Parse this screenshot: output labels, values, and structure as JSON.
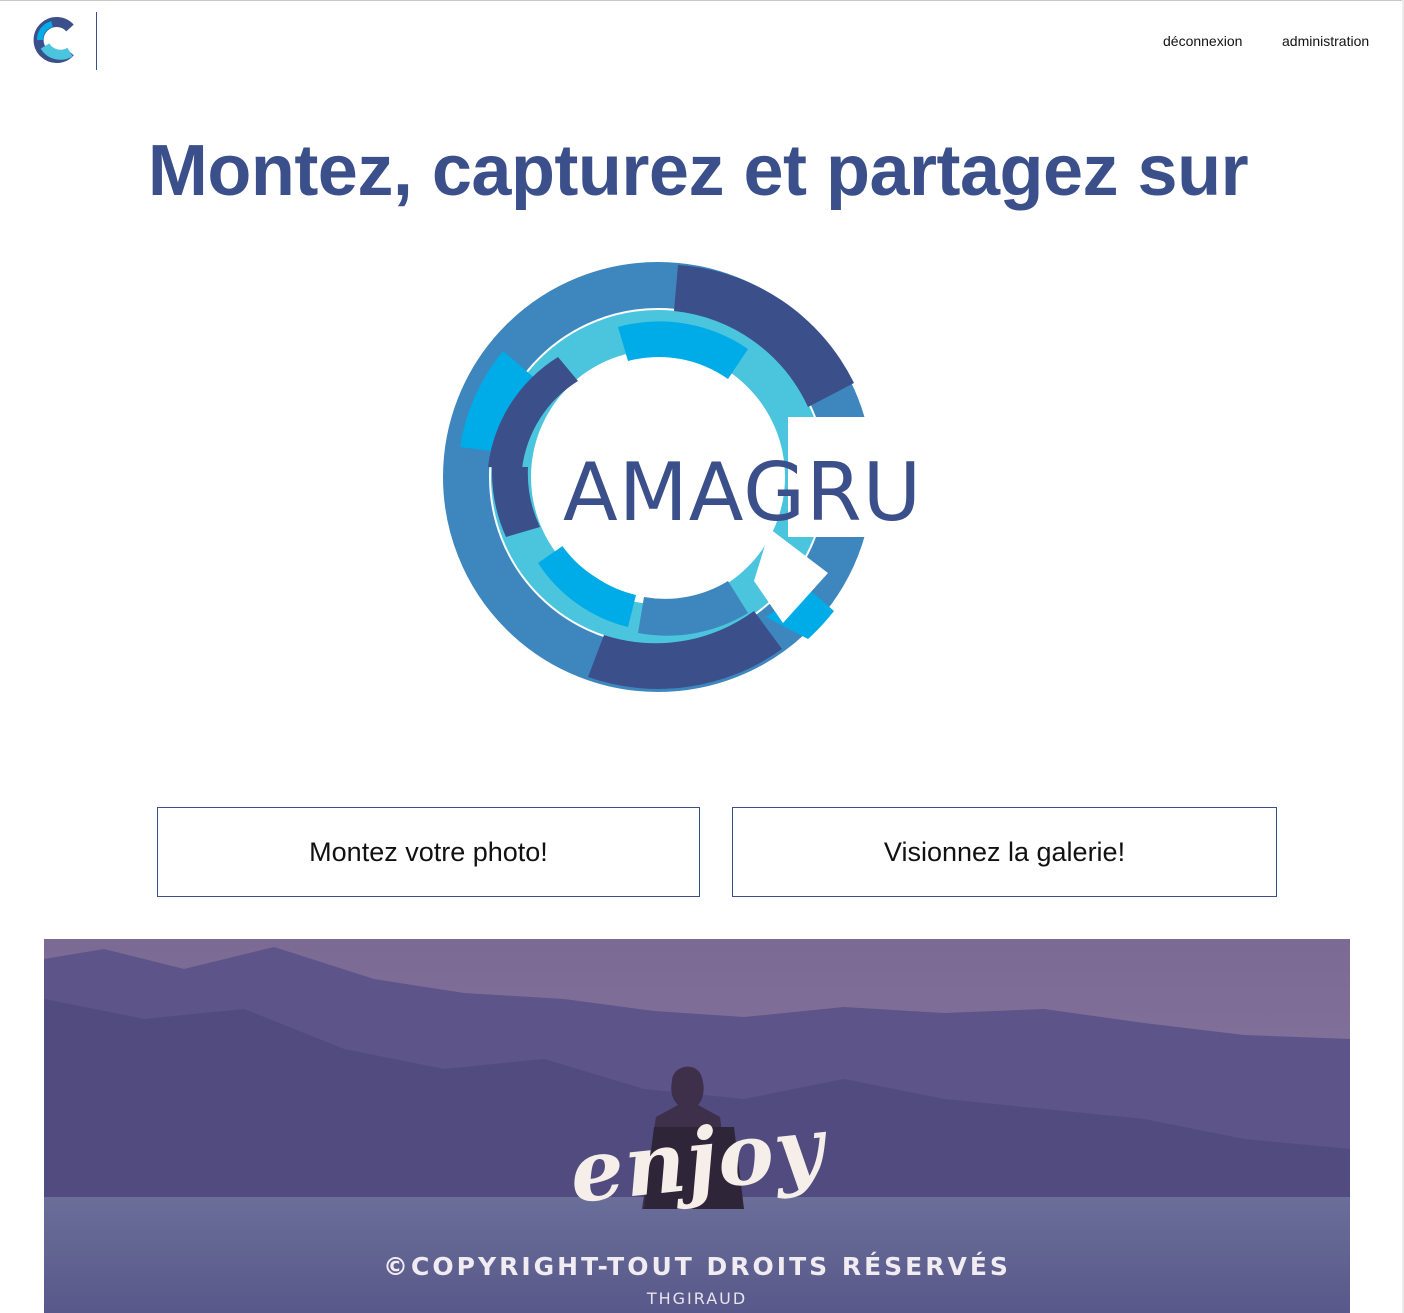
{
  "header": {
    "nav": {
      "logout": "déconnexion",
      "admin": "administration"
    }
  },
  "hero": {
    "headline": "Montez, capturez et partagez sur",
    "logo_text": "AMAGRU"
  },
  "actions": {
    "upload_label": "Montez votre photo!",
    "gallery_label": "Visionnez la galerie!"
  },
  "banner": {
    "enjoy": "enjoy",
    "copyright": "©COPYRIGHT-TOUT DROITS RÉSERVÉS",
    "author": "THGIRAUD"
  },
  "colors": {
    "brand_navy": "#3b4f8a",
    "brand_blue": "#3d87be",
    "brand_cyan": "#00ace7",
    "brand_light_cyan": "#4bc5de",
    "banner_overlay": "#6e5a8e"
  },
  "icons": {
    "header_logo": "camagru-logo-icon"
  }
}
